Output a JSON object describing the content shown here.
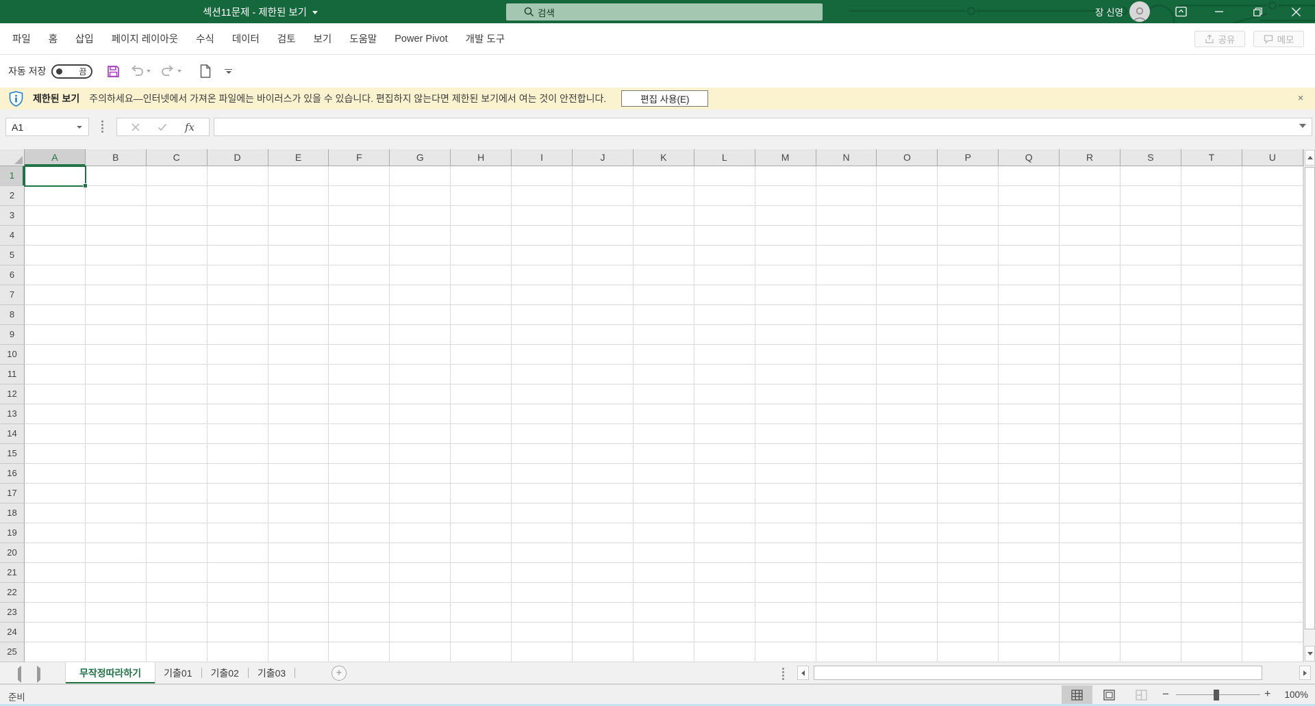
{
  "colors": {
    "titlebar_green": "#15673c",
    "accent_green": "#217346",
    "banner_yellow": "#fbf3cf",
    "save_icon_purple": "#a83fc2",
    "shield_blue": "#1f7fd0"
  },
  "title_bar": {
    "document_title": "섹션11문제 - 제한된 보기",
    "search_placeholder": "검색",
    "user_name": "장 신영"
  },
  "ribbon": {
    "tabs": [
      "파일",
      "홈",
      "삽입",
      "페이지 레이아웃",
      "수식",
      "데이터",
      "검토",
      "보기",
      "도움말",
      "Power Pivot",
      "개발 도구"
    ],
    "share_label": "공유",
    "comments_label": "메모"
  },
  "quick_access": {
    "autosave_label": "자동 저장",
    "autosave_state": "끔"
  },
  "protected_view": {
    "title": "제한된 보기",
    "message": "주의하세요—인터넷에서 가져온 파일에는 바이러스가 있을 수 있습니다. 편집하지 않는다면 제한된 보기에서 여는 것이 안전합니다.",
    "enable_edit_button": "편집 사용(E)",
    "close_label": "×"
  },
  "formula_bar": {
    "name_box_value": "A1",
    "function_label": "fx",
    "formula_value": ""
  },
  "grid": {
    "columns": [
      "A",
      "B",
      "C",
      "D",
      "E",
      "F",
      "G",
      "H",
      "I",
      "J",
      "K",
      "L",
      "M",
      "N",
      "O",
      "P",
      "Q",
      "R",
      "S",
      "T",
      "U"
    ],
    "row_count": 25,
    "selected_cell": "A1",
    "selected_column": "A",
    "selected_row": "1"
  },
  "sheet_tabs": {
    "tabs": [
      {
        "label": "무작정따라하기",
        "active": true
      },
      {
        "label": "기출01",
        "active": false
      },
      {
        "label": "기출02",
        "active": false
      },
      {
        "label": "기출03",
        "active": false
      }
    ]
  },
  "status_bar": {
    "mode": "준비",
    "zoom_level": "100%"
  }
}
